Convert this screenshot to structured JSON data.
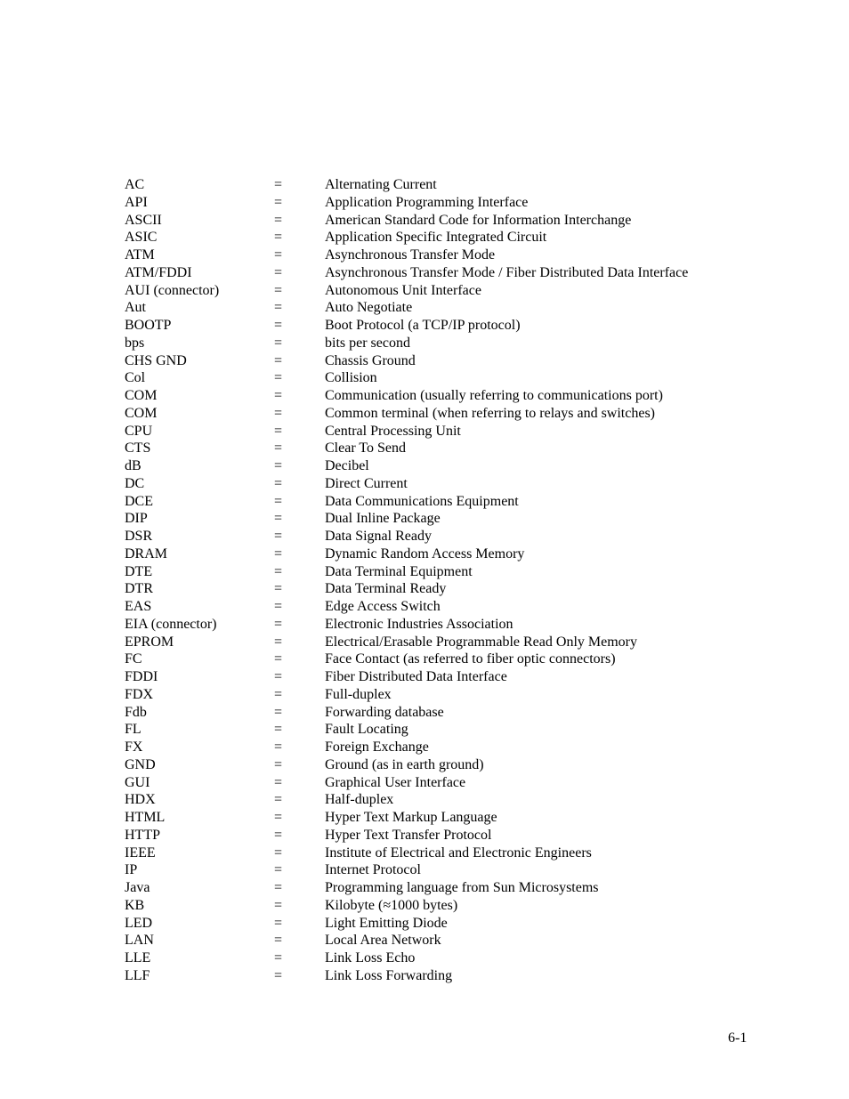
{
  "glossary": {
    "separator": "=",
    "entries": [
      {
        "term": "AC",
        "definition": "Alternating Current"
      },
      {
        "term": "API",
        "definition": "Application Programming Interface"
      },
      {
        "term": "ASCII",
        "definition": "American Standard Code for Information Interchange"
      },
      {
        "term": "ASIC",
        "definition": "Application Specific Integrated Circuit"
      },
      {
        "term": "ATM",
        "definition": "Asynchronous Transfer Mode"
      },
      {
        "term": "ATM/FDDI",
        "definition": "Asynchronous Transfer Mode / Fiber Distributed Data Interface"
      },
      {
        "term": "AUI (connector)",
        "definition": "Autonomous Unit Interface"
      },
      {
        "term": "Aut",
        "definition": "Auto Negotiate"
      },
      {
        "term": "BOOTP",
        "definition": "Boot Protocol (a TCP/IP protocol)"
      },
      {
        "term": "bps",
        "definition": "bits per second"
      },
      {
        "term": "CHS GND",
        "definition": "Chassis Ground"
      },
      {
        "term": "Col",
        "definition": "Collision"
      },
      {
        "term": "COM",
        "definition": "Communication (usually referring to communications port)"
      },
      {
        "term": "COM",
        "definition": "Common terminal (when referring to relays and switches)"
      },
      {
        "term": "CPU",
        "definition": "Central Processing Unit"
      },
      {
        "term": "CTS",
        "definition": "Clear To Send"
      },
      {
        "term": "dB",
        "definition": "Decibel"
      },
      {
        "term": "DC",
        "definition": "Direct Current"
      },
      {
        "term": "DCE",
        "definition": "Data Communications Equipment"
      },
      {
        "term": "DIP",
        "definition": "Dual Inline Package"
      },
      {
        "term": "DSR",
        "definition": "Data Signal Ready"
      },
      {
        "term": "DRAM",
        "definition": "Dynamic Random Access Memory"
      },
      {
        "term": "DTE",
        "definition": "Data Terminal Equipment"
      },
      {
        "term": "DTR",
        "definition": "Data Terminal Ready"
      },
      {
        "term": "EAS",
        "definition": "Edge Access Switch"
      },
      {
        "term": "EIA (connector)",
        "definition": "Electronic Industries Association"
      },
      {
        "term": "EPROM",
        "definition": "Electrical/Erasable Programmable Read Only Memory"
      },
      {
        "term": "FC",
        "definition": "Face Contact (as referred to fiber optic connectors)"
      },
      {
        "term": "FDDI",
        "definition": "Fiber Distributed Data Interface"
      },
      {
        "term": "FDX",
        "definition": "Full-duplex"
      },
      {
        "term": "Fdb",
        "definition": "Forwarding database"
      },
      {
        "term": "FL",
        "definition": "Fault Locating"
      },
      {
        "term": "FX",
        "definition": "Foreign Exchange"
      },
      {
        "term": "GND",
        "definition": "Ground (as in earth ground)"
      },
      {
        "term": "GUI",
        "definition": "Graphical User Interface"
      },
      {
        "term": "HDX",
        "definition": "Half-duplex"
      },
      {
        "term": "HTML",
        "definition": "Hyper Text Markup Language"
      },
      {
        "term": "HTTP",
        "definition": "Hyper Text Transfer Protocol"
      },
      {
        "term": "IEEE",
        "definition": "Institute of Electrical and Electronic Engineers"
      },
      {
        "term": "IP",
        "definition": "Internet Protocol"
      },
      {
        "term": "Java",
        "definition": "Programming language from Sun Microsystems"
      },
      {
        "term": "KB",
        "definition": "Kilobyte (≈1000 bytes)"
      },
      {
        "term": "LED",
        "definition": "Light Emitting Diode"
      },
      {
        "term": "LAN",
        "definition": "Local Area Network"
      },
      {
        "term": "LLE",
        "definition": "Link Loss Echo"
      },
      {
        "term": "LLF",
        "definition": "Link Loss Forwarding"
      }
    ]
  },
  "footer": {
    "page_number": "6-1"
  }
}
